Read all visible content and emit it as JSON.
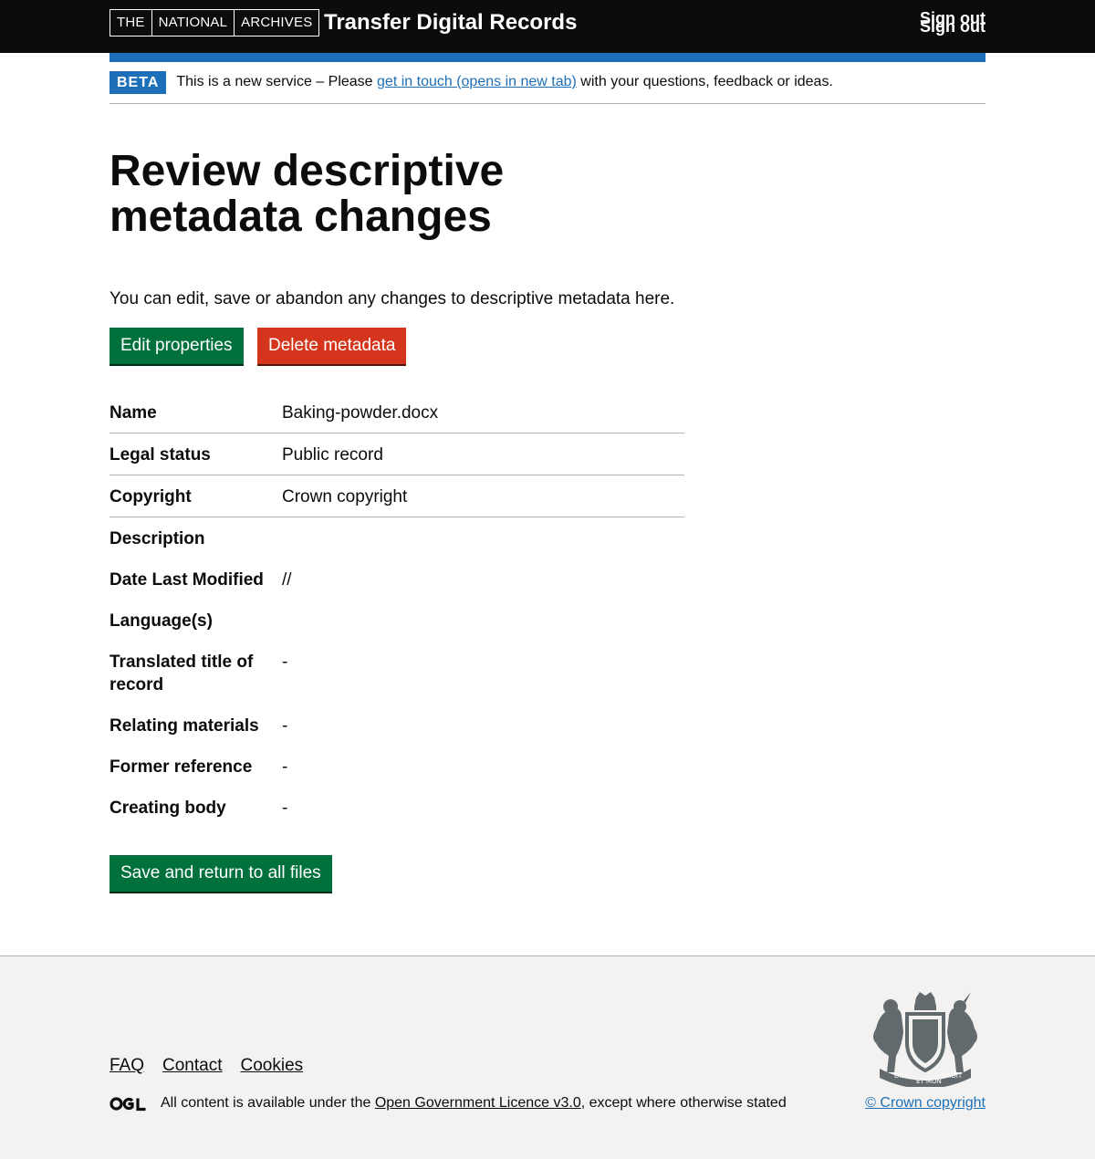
{
  "header": {
    "logo_parts": [
      "THE",
      "NATIONAL",
      "ARCHIVES"
    ],
    "service_name": "Transfer Digital Records",
    "sign_out": "Sign out"
  },
  "beta_banner": {
    "tag": "BETA",
    "text_before": "This is a new service – Please ",
    "link": "get in touch (opens in new tab)",
    "text_after": " with your questions, feedback or ideas."
  },
  "main": {
    "title": "Review descriptive metadata changes",
    "lead": "You can edit, save or abandon any changes to descriptive metadata here.",
    "edit_button": "Edit properties",
    "delete_button": "Delete metadata",
    "save_button": "Save and return to all files",
    "summary": [
      {
        "key": "Name",
        "value": "Baking-powder.docx"
      },
      {
        "key": "Legal status",
        "value": "Public record"
      },
      {
        "key": "Copyright",
        "value": "Crown copyright"
      },
      {
        "key": "Description",
        "value": ""
      },
      {
        "key": "Date Last Modified",
        "value": "//"
      },
      {
        "key": "Language(s)",
        "value": ""
      },
      {
        "key": "Translated title of record",
        "value": "-"
      },
      {
        "key": "Relating materials",
        "value": "-"
      },
      {
        "key": "Former reference",
        "value": "-"
      },
      {
        "key": "Creating body",
        "value": "-"
      }
    ]
  },
  "footer": {
    "links": [
      "FAQ",
      "Contact",
      "Cookies"
    ],
    "licence_before": "All content is available under the ",
    "licence_link": "Open Government Licence v3.0",
    "licence_after": ", except where otherwise stated",
    "crown_copyright": "© Crown copyright",
    "crest_text": [
      "DIEU",
      "ET MON",
      "DROIT"
    ]
  },
  "colors": {
    "header_bg": "#0b0c0c",
    "brand_blue": "#1d70b8",
    "button_green": "#00703c",
    "button_red": "#d4351c",
    "footer_bg": "#f3f2f1"
  }
}
